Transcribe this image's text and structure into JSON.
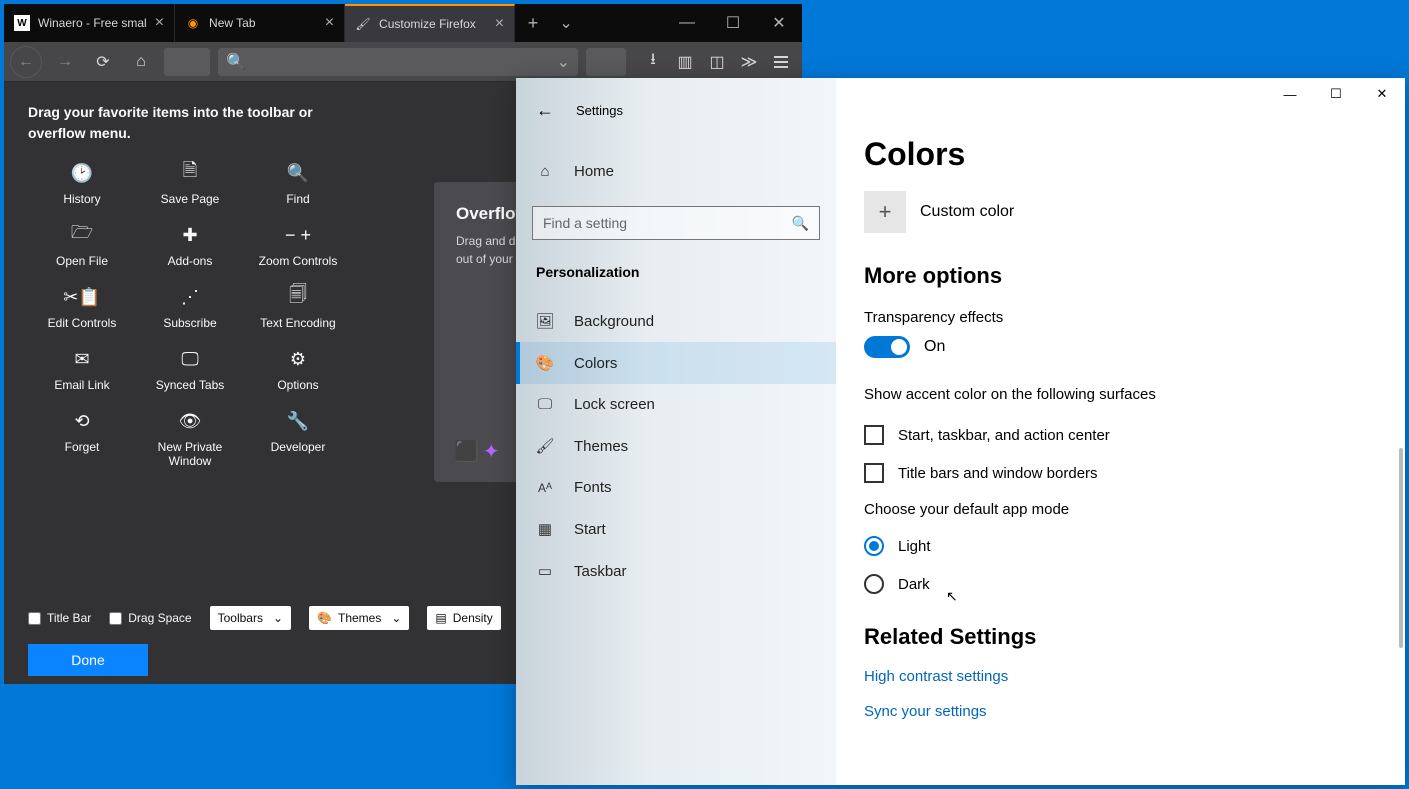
{
  "firefox": {
    "tabs": [
      {
        "label": "Winaero - Free smal"
      },
      {
        "label": "New Tab"
      },
      {
        "label": "Customize Firefox"
      }
    ],
    "customize": {
      "header": "Drag your favorite items into the toolbar or overflow menu.",
      "items": [
        "History",
        "Save Page",
        "Find",
        "Open File",
        "Add-ons",
        "Zoom Controls",
        "Edit Controls",
        "Subscribe",
        "Text Encoding",
        "Email Link",
        "Synced Tabs",
        "Options",
        "Forget",
        "New Private Window",
        "Developer"
      ],
      "overflow_title": "Overflow",
      "overflow_body": "Drag and drop items here to keep them within reach but out of your toolbar…",
      "footer": {
        "title_bar": "Title Bar",
        "drag_space": "Drag Space",
        "toolbars": "Toolbars",
        "themes": "Themes",
        "density": "Density",
        "done": "Done"
      }
    }
  },
  "settings": {
    "title": "Settings",
    "home": "Home",
    "search_placeholder": "Find a setting",
    "group": "Personalization",
    "nav": [
      "Background",
      "Colors",
      "Lock screen",
      "Themes",
      "Fonts",
      "Start",
      "Taskbar"
    ],
    "main": {
      "heading": "Colors",
      "custom_color": "Custom color",
      "more_options": "More options",
      "transparency_label": "Transparency effects",
      "transparency_value": "On",
      "accent_label": "Show accent color on the following surfaces",
      "accent_check1": "Start, taskbar, and action center",
      "accent_check2": "Title bars and window borders",
      "mode_label": "Choose your default app mode",
      "mode_light": "Light",
      "mode_dark": "Dark",
      "related": "Related Settings",
      "link1": "High contrast settings",
      "link2": "Sync your settings"
    }
  }
}
